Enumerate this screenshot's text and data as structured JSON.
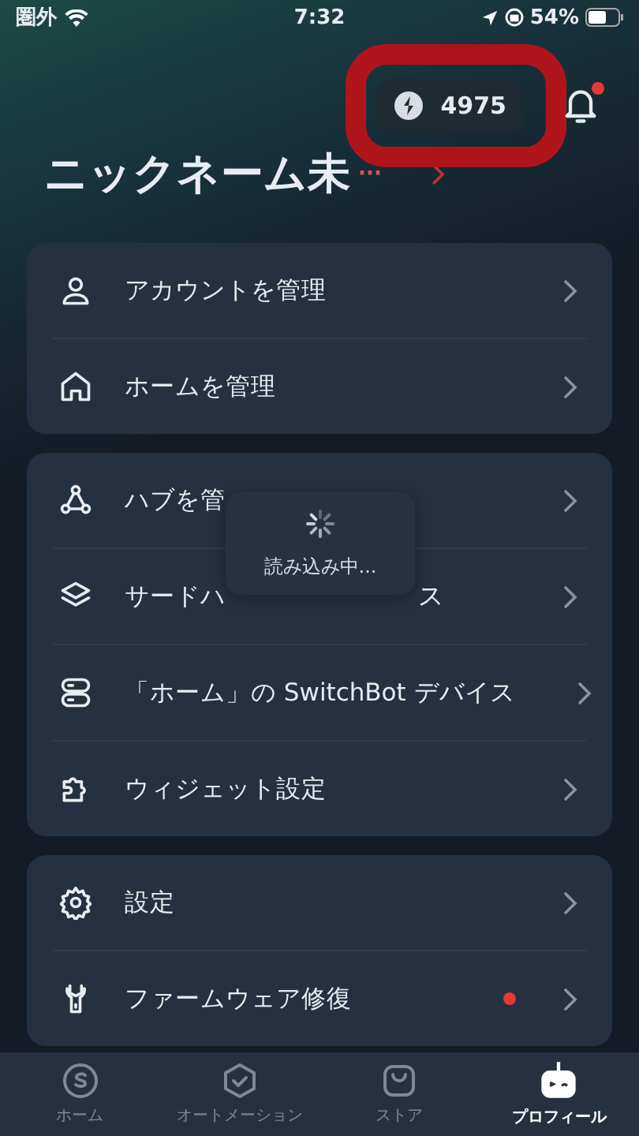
{
  "status_bar": {
    "carrier": "圏外",
    "time": "7:32",
    "battery": "54%"
  },
  "header": {
    "points": "4975",
    "points_highlighted": true,
    "notification_dot": true,
    "nickname": "ニックネーム未",
    "ellipsis": "···"
  },
  "groups": [
    {
      "items": [
        {
          "kind": "person",
          "label": "アカウントを管理",
          "dot": false
        },
        {
          "kind": "house",
          "label": "ホームを管理",
          "dot": false
        }
      ]
    },
    {
      "items": [
        {
          "kind": "hub",
          "label": "ハブを管",
          "dot": false
        },
        {
          "kind": "layers",
          "label": "サードハ",
          "label_tail": "ス",
          "dot": false
        },
        {
          "kind": "devices",
          "label": "「ホーム」の SwitchBot デバイス",
          "dot": false
        },
        {
          "kind": "puzzle",
          "label": "ウィジェット設定",
          "dot": false
        }
      ]
    },
    {
      "items": [
        {
          "kind": "gear",
          "label": "設定",
          "dot": false
        },
        {
          "kind": "wrench",
          "label": "ファームウェア修復",
          "dot": true
        }
      ]
    }
  ],
  "loading": {
    "text": "読み込み中..."
  },
  "tab_bar": [
    {
      "kind": "coin",
      "label": "ホーム",
      "selected": false
    },
    {
      "kind": "check",
      "label": "オートメーション",
      "selected": false
    },
    {
      "kind": "bag",
      "label": "ストア",
      "selected": false
    },
    {
      "kind": "bot",
      "label": "プロフィール",
      "selected": true
    }
  ]
}
